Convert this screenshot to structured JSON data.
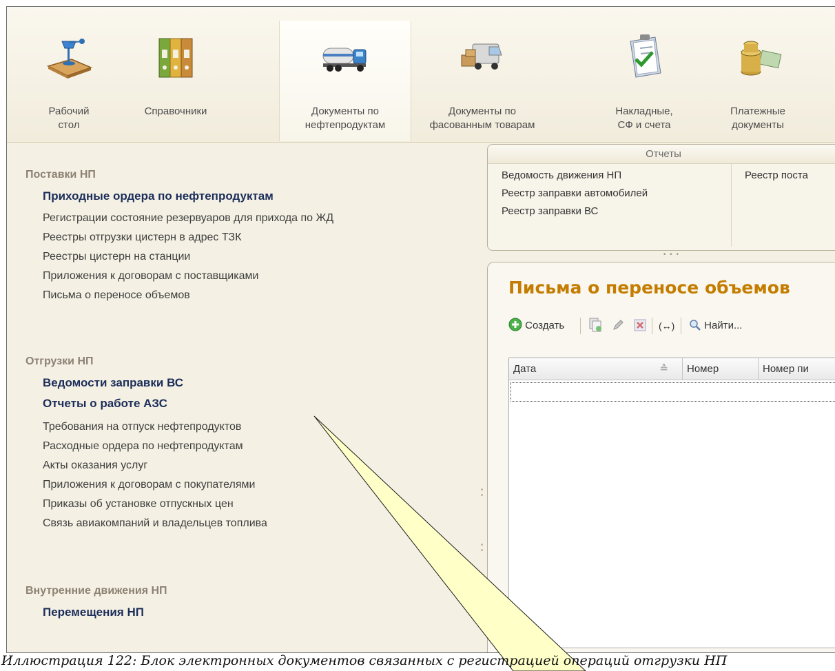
{
  "sections": [
    {
      "label": "Рабочий\nстол",
      "icon": "desk-lamp-icon"
    },
    {
      "label": "Справочники",
      "icon": "binders-icon"
    },
    {
      "label": "Документы по\nнефтепродуктам",
      "icon": "fuel-truck-icon"
    },
    {
      "label": "Документы по\nфасованным товарам",
      "icon": "delivery-van-icon"
    },
    {
      "label": "Накладные,\nСФ и счета",
      "icon": "clipboard-checklist-icon"
    },
    {
      "label": "Платежные\nдокументы",
      "icon": "coins-icon"
    }
  ],
  "nav": {
    "group1": "Поставки НП",
    "group1_items": [
      "Приходные ордера по нефтепродуктам",
      "Регистрации состояние резервуаров для прихода по ЖД",
      "Реестры отгрузки цистерн в адрес ТЗК",
      "Реестры цистерн на станции",
      "Приложения к договорам с поставщиками",
      "Письма о переносе объемов"
    ],
    "group2": "Отгрузки НП",
    "group2_items": [
      "Ведомости заправки ВС",
      "Отчеты о работе АЗС",
      "Требования на отпуск нефтепродуктов",
      "Расходные ордера по нефтепродуктам",
      "Акты оказания услуг",
      "Приложения к договорам с покупателями",
      "Приказы об установке отпускных цен",
      "Связь авиакомпаний и владельцев топлива"
    ],
    "group3": "Внутренние движения НП",
    "group3_items": [
      "Перемещения НП"
    ]
  },
  "reports": {
    "header": "Отчеты",
    "col1": [
      "Ведомость движения НП",
      "Реестр заправки автомобилей",
      "Реестр заправки ВС"
    ],
    "col2": [
      "Реестр поста"
    ]
  },
  "docs": {
    "title": "Письма о переносе объемов",
    "toolbar": {
      "create": "Создать",
      "find": "Найти..."
    },
    "columns": [
      "Дата",
      "Номер",
      "Номер пи"
    ]
  },
  "caption": "Иллюстрация 122: Блок электронных документов связанных с регистрацией операций отгрузки НП",
  "colors": {
    "title": "#c47d00",
    "bold_link": "#1c2d5a",
    "group": "#8d8173",
    "callout": "#ffffc8"
  }
}
